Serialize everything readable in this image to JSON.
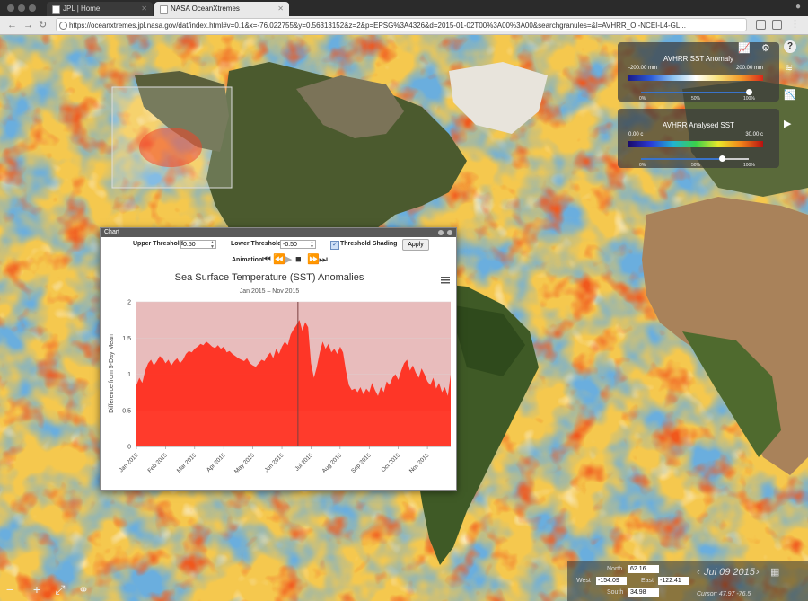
{
  "browser": {
    "tabs": [
      {
        "label": "JPL | Home"
      },
      {
        "label": "NASA OceanXtremes"
      }
    ],
    "url": "https://oceanxtremes.jpl.nasa.gov/dat/index.html#v=0.1&x=-76.022755&y=0.56313152&z=2&p=EPSG%3A4326&d=2015-01-02T00%3A00%3A00&searchgranules=&l=AVHRR_OI-NCEI-L4-GL..."
  },
  "layers": [
    {
      "title": "AVHRR SST Anomaly",
      "min_label": "-200.00 mm",
      "max_label": "200.00 mm",
      "ticks": [
        "0%",
        "50%",
        "100%"
      ],
      "opacity": 1.0
    },
    {
      "title": "AVHRR Analysed SST",
      "min_label": "0.00 c",
      "max_label": "30.00 c",
      "ticks": [
        "0%",
        "50%",
        "100%"
      ],
      "opacity": 0.75
    }
  ],
  "side_icons": {
    "chart": "chart-icon",
    "settings": "gear-icon",
    "help": "question-icon",
    "layers": "layers-icon",
    "video": "camera-icon"
  },
  "chart_window": {
    "title": "Chart",
    "upper_threshold_label": "Upper Threshold",
    "upper_threshold_value": "0.50",
    "lower_threshold_label": "Lower Threshold",
    "lower_threshold_value": "-0.50",
    "threshold_shading_label": "Threshold Shading",
    "threshold_shading_checked": true,
    "apply_label": "Apply",
    "animation_label": "Animation"
  },
  "chart_data": {
    "type": "area",
    "title": "Sea Surface Temperature (SST) Anomalies",
    "subtitle": "Jan 2015 – Nov 2015",
    "xlabel": "",
    "ylabel": "Difference from 5-Day Mean",
    "ylim": [
      0,
      2
    ],
    "yticks": [
      "0",
      "0.5",
      "1",
      "1.5",
      "2"
    ],
    "x_tick_labels": [
      "Jan 2015",
      "Feb 2015",
      "Mar 2015",
      "Apr 2015",
      "May 2015",
      "Jun 2015",
      "Jul 2015",
      "Aug 2015",
      "Sep 2015",
      "Oct 2015",
      "Nov 2015"
    ],
    "x_range_months": [
      0,
      10.8
    ],
    "threshold_band": [
      0.5,
      2
    ],
    "cursor_month": 5.55,
    "color": "#ff2a1a",
    "series": [
      {
        "points": [
          [
            0.0,
            0.85
          ],
          [
            0.1,
            0.95
          ],
          [
            0.2,
            0.88
          ],
          [
            0.3,
            1.05
          ],
          [
            0.4,
            1.15
          ],
          [
            0.5,
            1.2
          ],
          [
            0.6,
            1.12
          ],
          [
            0.7,
            1.18
          ],
          [
            0.8,
            1.25
          ],
          [
            0.9,
            1.22
          ],
          [
            1.0,
            1.15
          ],
          [
            1.1,
            1.2
          ],
          [
            1.2,
            1.12
          ],
          [
            1.3,
            1.18
          ],
          [
            1.4,
            1.22
          ],
          [
            1.5,
            1.15
          ],
          [
            1.6,
            1.2
          ],
          [
            1.7,
            1.28
          ],
          [
            1.8,
            1.32
          ],
          [
            1.9,
            1.3
          ],
          [
            2.0,
            1.35
          ],
          [
            2.1,
            1.38
          ],
          [
            2.2,
            1.42
          ],
          [
            2.3,
            1.4
          ],
          [
            2.4,
            1.45
          ],
          [
            2.5,
            1.42
          ],
          [
            2.6,
            1.38
          ],
          [
            2.7,
            1.36
          ],
          [
            2.8,
            1.4
          ],
          [
            2.9,
            1.35
          ],
          [
            3.0,
            1.38
          ],
          [
            3.1,
            1.3
          ],
          [
            3.2,
            1.32
          ],
          [
            3.3,
            1.28
          ],
          [
            3.4,
            1.25
          ],
          [
            3.5,
            1.22
          ],
          [
            3.6,
            1.2
          ],
          [
            3.7,
            1.18
          ],
          [
            3.8,
            1.22
          ],
          [
            3.9,
            1.15
          ],
          [
            4.0,
            1.12
          ],
          [
            4.1,
            1.1
          ],
          [
            4.2,
            1.15
          ],
          [
            4.3,
            1.2
          ],
          [
            4.4,
            1.18
          ],
          [
            4.5,
            1.25
          ],
          [
            4.6,
            1.3
          ],
          [
            4.7,
            1.22
          ],
          [
            4.8,
            1.35
          ],
          [
            4.9,
            1.28
          ],
          [
            5.0,
            1.38
          ],
          [
            5.1,
            1.45
          ],
          [
            5.2,
            1.4
          ],
          [
            5.3,
            1.55
          ],
          [
            5.4,
            1.62
          ],
          [
            5.5,
            1.68
          ],
          [
            5.6,
            1.75
          ],
          [
            5.7,
            1.6
          ],
          [
            5.8,
            1.72
          ],
          [
            5.9,
            1.65
          ],
          [
            6.0,
            1.15
          ],
          [
            6.1,
            0.95
          ],
          [
            6.2,
            1.1
          ],
          [
            6.3,
            1.3
          ],
          [
            6.4,
            1.45
          ],
          [
            6.5,
            1.35
          ],
          [
            6.6,
            1.42
          ],
          [
            6.7,
            1.3
          ],
          [
            6.8,
            1.35
          ],
          [
            6.9,
            1.28
          ],
          [
            7.0,
            1.38
          ],
          [
            7.1,
            1.3
          ],
          [
            7.2,
            1.05
          ],
          [
            7.3,
            0.85
          ],
          [
            7.4,
            0.78
          ],
          [
            7.5,
            0.8
          ],
          [
            7.6,
            0.75
          ],
          [
            7.7,
            0.82
          ],
          [
            7.8,
            0.72
          ],
          [
            7.9,
            0.8
          ],
          [
            8.0,
            0.75
          ],
          [
            8.1,
            0.88
          ],
          [
            8.2,
            0.78
          ],
          [
            8.3,
            0.7
          ],
          [
            8.4,
            0.82
          ],
          [
            8.5,
            0.75
          ],
          [
            8.6,
            0.9
          ],
          [
            8.7,
            0.85
          ],
          [
            8.8,
            0.95
          ],
          [
            8.9,
            1.0
          ],
          [
            9.0,
            0.92
          ],
          [
            9.1,
            1.05
          ],
          [
            9.2,
            1.15
          ],
          [
            9.3,
            1.2
          ],
          [
            9.4,
            1.05
          ],
          [
            9.5,
            1.12
          ],
          [
            9.6,
            1.02
          ],
          [
            9.7,
            0.95
          ],
          [
            9.8,
            1.08
          ],
          [
            9.9,
            1.0
          ],
          [
            10.0,
            0.9
          ],
          [
            10.1,
            0.85
          ],
          [
            10.2,
            0.95
          ],
          [
            10.3,
            0.8
          ],
          [
            10.4,
            0.88
          ],
          [
            10.5,
            0.75
          ],
          [
            10.6,
            0.82
          ],
          [
            10.7,
            0.7
          ],
          [
            10.8,
            1.0
          ]
        ]
      }
    ]
  },
  "coords": {
    "north_label": "North",
    "north_value": "62.16",
    "west_label": "West",
    "west_value": "-154.09",
    "east_label": "East",
    "east_value": "-122.41",
    "south_label": "South",
    "south_value": "34.98",
    "date": "Jul 09 2015",
    "secondary_text": "Cursor: 47.97 -76.5"
  },
  "map_controls": {
    "zoom_out": "−",
    "zoom_in": "+",
    "fullscreen": "⤢",
    "link": "⚭"
  }
}
